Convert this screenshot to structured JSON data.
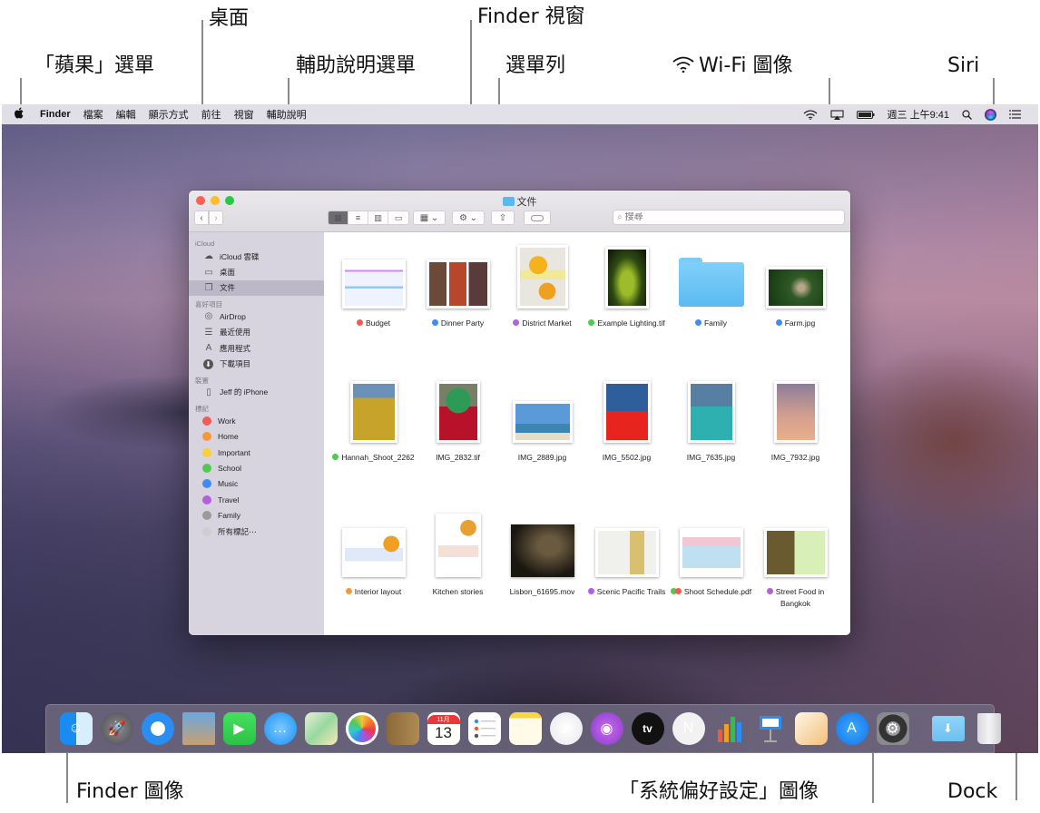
{
  "callouts": {
    "desktop": "桌面",
    "finder_window": "Finder 視窗",
    "apple_menu": "「蘋果」選單",
    "help_menu": "輔助說明選單",
    "menu_bar": "選單列",
    "wifi_icon": "Wi-Fi 圖像",
    "siri": "Siri",
    "finder_icon": "Finder 圖像",
    "system_prefs_icon": "「系統偏好設定」圖像",
    "dock": "Dock"
  },
  "menubar": {
    "apple": "",
    "app_name": "Finder",
    "items": [
      "檔案",
      "編輯",
      "顯示方式",
      "前往",
      "視窗",
      "輔助說明"
    ],
    "status_icons": [
      "wifi-icon",
      "airplay-icon",
      "battery-icon"
    ],
    "clock": "週三 上午9:41",
    "right_icons": [
      "spotlight-icon",
      "siri-icon",
      "notification-center-icon"
    ]
  },
  "finder": {
    "title": "文件",
    "search_placeholder": "搜尋",
    "view_modes": [
      "icon",
      "list",
      "column",
      "gallery"
    ],
    "active_view": "icon",
    "sidebar": {
      "sections": [
        {
          "heading": "iCloud",
          "items": [
            {
              "label": "iCloud 雲碟",
              "icon": "cloud-icon"
            },
            {
              "label": "桌面",
              "icon": "desktop-icon"
            },
            {
              "label": "文件",
              "icon": "documents-icon",
              "selected": true
            }
          ]
        },
        {
          "heading": "喜好項目",
          "items": [
            {
              "label": "AirDrop",
              "icon": "airdrop-icon"
            },
            {
              "label": "最近使用",
              "icon": "recents-icon"
            },
            {
              "label": "應用程式",
              "icon": "applications-icon"
            },
            {
              "label": "下載項目",
              "icon": "downloads-icon"
            }
          ]
        },
        {
          "heading": "裝置",
          "items": [
            {
              "label": "Jeff 的 iPhone",
              "icon": "iphone-icon"
            }
          ]
        }
      ],
      "tags_heading": "標記",
      "tags": [
        {
          "label": "Work",
          "color": "#f25a55"
        },
        {
          "label": "Home",
          "color": "#f7973c"
        },
        {
          "label": "Important",
          "color": "#f8cf3c"
        },
        {
          "label": "School",
          "color": "#4fc94f"
        },
        {
          "label": "Music",
          "color": "#3f8cf5"
        },
        {
          "label": "Travel",
          "color": "#b55fd8"
        },
        {
          "label": "Family",
          "color": "#9a9a9c"
        },
        {
          "label": "所有標記⋯",
          "color": "#cfcdd2"
        }
      ]
    },
    "files": [
      {
        "name": "Budget",
        "tags": [
          "#f25a55"
        ],
        "kind": "spreadsheet"
      },
      {
        "name": "Dinner Party",
        "tags": [
          "#3f8cf5"
        ],
        "kind": "document"
      },
      {
        "name": "District Market",
        "tags": [
          "#b55fd8"
        ],
        "kind": "poster"
      },
      {
        "name": "Example Lighting.tif",
        "tags": [
          "#4fc94f"
        ],
        "kind": "photo-portrait"
      },
      {
        "name": "Family",
        "tags": [
          "#3f8cf5"
        ],
        "kind": "folder"
      },
      {
        "name": "Farm.jpg",
        "tags": [
          "#3f8cf5"
        ],
        "kind": "photo-landscape"
      },
      {
        "name": "Hannah_Shoot_2262",
        "tags": [
          "#4fc94f"
        ],
        "kind": "photo-portrait"
      },
      {
        "name": "IMG_2832.tif",
        "tags": [],
        "kind": "photo-portrait"
      },
      {
        "name": "IMG_2889.jpg",
        "tags": [],
        "kind": "photo-landscape"
      },
      {
        "name": "IMG_5502.jpg",
        "tags": [],
        "kind": "photo-portrait"
      },
      {
        "name": "IMG_7635.jpg",
        "tags": [],
        "kind": "photo-portrait"
      },
      {
        "name": "IMG_7932.jpg",
        "tags": [],
        "kind": "photo-portrait"
      },
      {
        "name": "Interior layout",
        "tags": [
          "#f7973c"
        ],
        "kind": "document"
      },
      {
        "name": "Kitchen stories",
        "tags": [],
        "kind": "poster"
      },
      {
        "name": "Lisbon_61695.mov",
        "tags": [],
        "kind": "video"
      },
      {
        "name": "Scenic Pacific Trails",
        "tags": [
          "#b55fd8"
        ],
        "kind": "document"
      },
      {
        "name": "Shoot Schedule.pdf",
        "tags": [
          "#4fc94f",
          "#f25a55"
        ],
        "kind": "pdf"
      },
      {
        "name": "Street Food in Bangkok",
        "tags": [
          "#b55fd8"
        ],
        "kind": "document"
      }
    ]
  },
  "dock": {
    "apps": [
      {
        "name": "Finder",
        "icon": "finder-icon"
      },
      {
        "name": "Launchpad",
        "icon": "launchpad-icon"
      },
      {
        "name": "Safari",
        "icon": "safari-icon"
      },
      {
        "name": "Mail",
        "icon": "mail-icon"
      },
      {
        "name": "FaceTime",
        "icon": "facetime-icon"
      },
      {
        "name": "Messages",
        "icon": "messages-icon"
      },
      {
        "name": "Maps",
        "icon": "maps-icon"
      },
      {
        "name": "Photos",
        "icon": "photos-icon"
      },
      {
        "name": "Contacts",
        "icon": "contacts-icon"
      },
      {
        "name": "Calendar",
        "icon": "calendar-icon",
        "month": "11月",
        "day": "13"
      },
      {
        "name": "Reminders",
        "icon": "reminders-icon"
      },
      {
        "name": "Notes",
        "icon": "notes-icon"
      },
      {
        "name": "Music",
        "icon": "music-icon"
      },
      {
        "name": "Podcasts",
        "icon": "podcasts-icon"
      },
      {
        "name": "TV",
        "icon": "tv-icon",
        "label": "tv"
      },
      {
        "name": "News",
        "icon": "news-icon"
      },
      {
        "name": "Numbers",
        "icon": "numbers-icon"
      },
      {
        "name": "Keynote",
        "icon": "keynote-icon"
      },
      {
        "name": "Pages",
        "icon": "pages-icon"
      },
      {
        "name": "App Store",
        "icon": "app-store-icon"
      },
      {
        "name": "System Preferences",
        "icon": "system-preferences-icon"
      }
    ],
    "stacks": [
      {
        "name": "Downloads",
        "icon": "downloads-folder-icon"
      },
      {
        "name": "Trash",
        "icon": "trash-icon"
      }
    ]
  }
}
